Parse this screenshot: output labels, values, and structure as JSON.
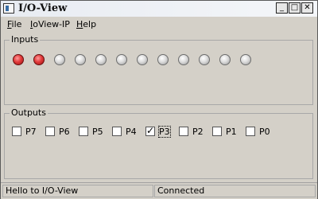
{
  "window": {
    "title": "I/O-View",
    "minimize_glyph": "_",
    "maximize_glyph": "□",
    "close_glyph": "✕"
  },
  "menu": [
    {
      "mnemonic": "F",
      "rest": "ile"
    },
    {
      "mnemonic": "I",
      "rest": "oView-IP"
    },
    {
      "mnemonic": "H",
      "rest": "elp"
    }
  ],
  "inputs": {
    "label": "Inputs",
    "leds": [
      true,
      true,
      false,
      false,
      false,
      false,
      false,
      false,
      false,
      false,
      false,
      false
    ]
  },
  "outputs": {
    "label": "Outputs",
    "bits": [
      {
        "label": "P7",
        "checked": false
      },
      {
        "label": "P6",
        "checked": false
      },
      {
        "label": "P5",
        "checked": false
      },
      {
        "label": "P4",
        "checked": false
      },
      {
        "label": "P3",
        "checked": true
      },
      {
        "label": "P2",
        "checked": false
      },
      {
        "label": "P1",
        "checked": false
      },
      {
        "label": "P0",
        "checked": false
      }
    ]
  },
  "status": {
    "message": "Hello to I/O-View",
    "connection": "Connected"
  },
  "colors": {
    "led_on": "#e23b3b",
    "led_off": "#dcdcdc",
    "window_bg": "#d4d0c8"
  }
}
